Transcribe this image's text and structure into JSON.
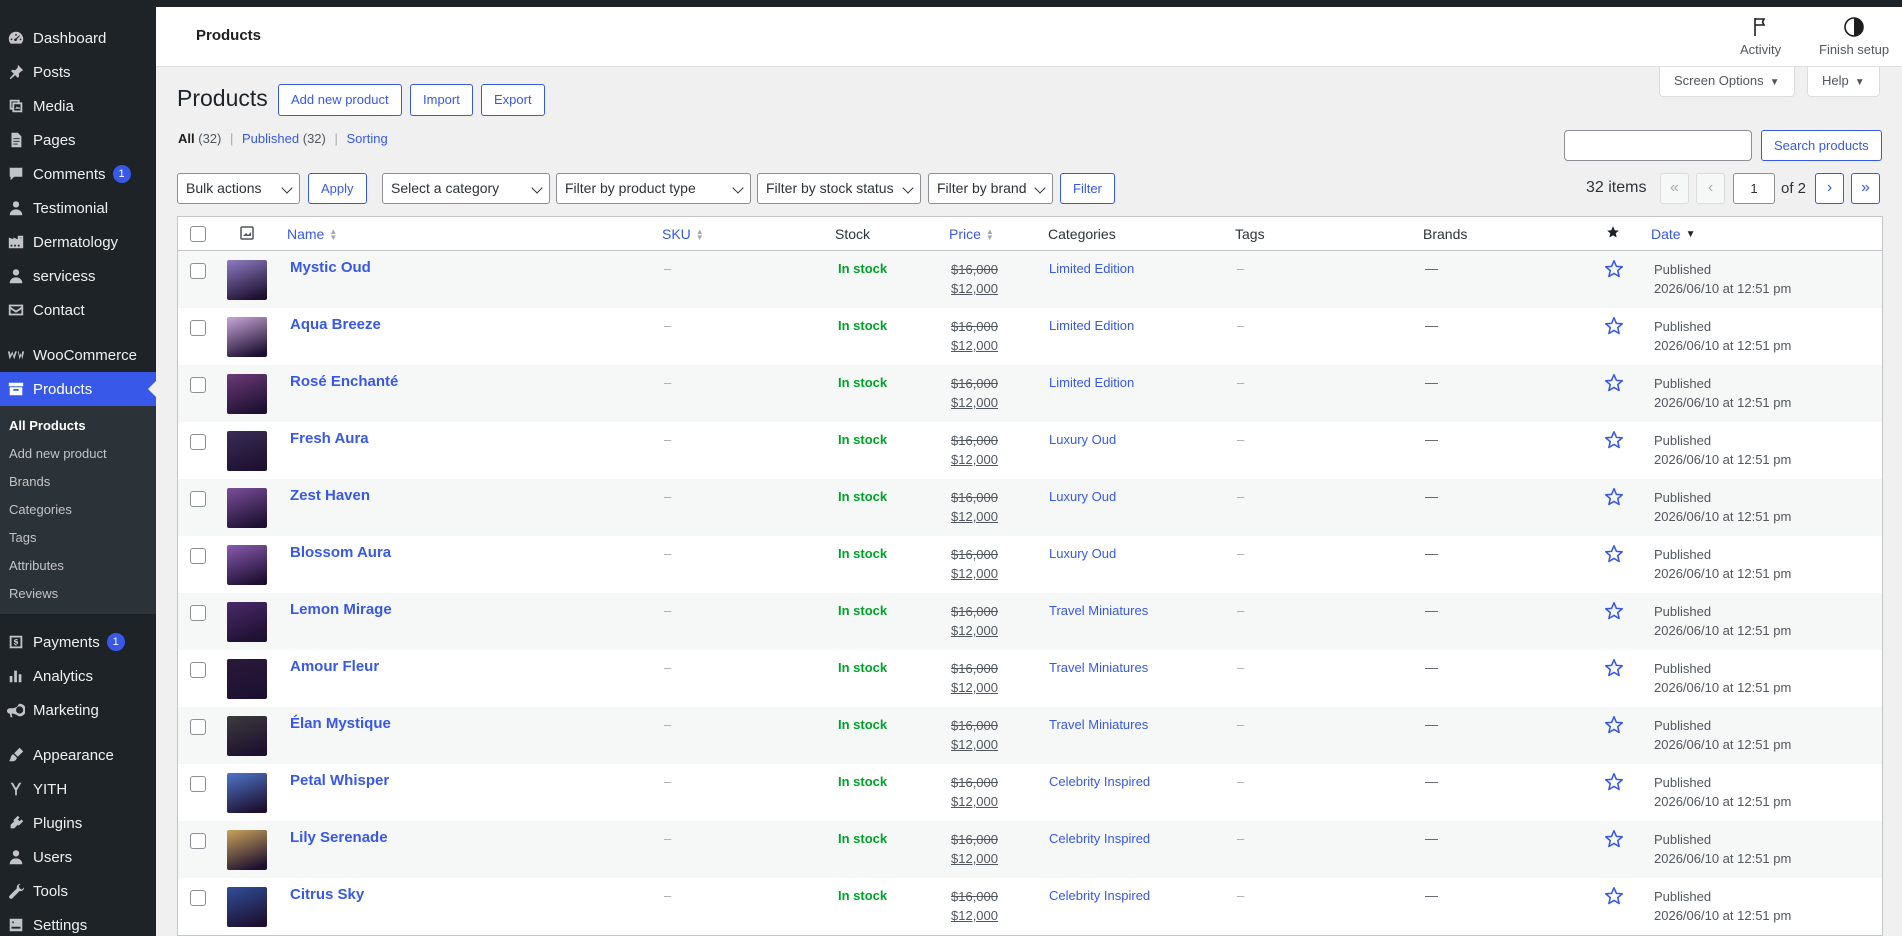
{
  "sidebar": {
    "items": [
      {
        "id": "dashboard",
        "label": "Dashboard",
        "icon": "dashboard-icon"
      },
      {
        "id": "posts",
        "label": "Posts",
        "icon": "pin-icon"
      },
      {
        "id": "media",
        "label": "Media",
        "icon": "media-icon"
      },
      {
        "id": "pages",
        "label": "Pages",
        "icon": "pages-icon"
      },
      {
        "id": "comments",
        "label": "Comments",
        "icon": "comment-icon",
        "badge": "1"
      },
      {
        "id": "testimonial",
        "label": "Testimonial",
        "icon": "user-icon"
      },
      {
        "id": "dermatology",
        "label": "Dermatology",
        "icon": "building-icon"
      },
      {
        "id": "servicess",
        "label": "servicess",
        "icon": "user-icon"
      },
      {
        "id": "contact",
        "label": "Contact",
        "icon": "mail-icon"
      },
      {
        "id": "woocommerce",
        "label": "WooCommerce",
        "icon": "woo-icon"
      },
      {
        "id": "products",
        "label": "Products",
        "icon": "archive-icon"
      }
    ],
    "submenu": [
      {
        "label": "All Products",
        "current": true
      },
      {
        "label": "Add new product"
      },
      {
        "label": "Brands"
      },
      {
        "label": "Categories"
      },
      {
        "label": "Tags"
      },
      {
        "label": "Attributes"
      },
      {
        "label": "Reviews"
      }
    ],
    "items_after": [
      {
        "id": "payments",
        "label": "Payments",
        "icon": "payments-icon",
        "badge": "1"
      },
      {
        "id": "analytics",
        "label": "Analytics",
        "icon": "chart-icon"
      },
      {
        "id": "marketing",
        "label": "Marketing",
        "icon": "megaphone-icon"
      },
      {
        "id": "appearance",
        "label": "Appearance",
        "icon": "brush-icon"
      },
      {
        "id": "yith",
        "label": "YITH",
        "icon": "yith-icon"
      },
      {
        "id": "plugins",
        "label": "Plugins",
        "icon": "plugin-icon"
      },
      {
        "id": "users",
        "label": "Users",
        "icon": "user-icon"
      },
      {
        "id": "tools",
        "label": "Tools",
        "icon": "wrench-icon"
      },
      {
        "id": "settings",
        "label": "Settings",
        "icon": "settings-icon"
      }
    ]
  },
  "header": {
    "breadcrumb": "Products",
    "activity_label": "Activity",
    "finish_setup_label": "Finish setup",
    "screen_options_label": "Screen Options",
    "help_label": "Help"
  },
  "page": {
    "title": "Products",
    "add_new_label": "Add new product",
    "import_label": "Import",
    "export_label": "Export"
  },
  "views": {
    "all_label": "All",
    "all_count": "(32)",
    "published_label": "Published",
    "published_count": "(32)",
    "sorting_label": "Sorting"
  },
  "search": {
    "button_label": "Search products",
    "value": ""
  },
  "filters": {
    "bulk_actions": "Bulk actions",
    "apply_label": "Apply",
    "category": "Select a category",
    "product_type": "Filter by product type",
    "stock_status": "Filter by stock status",
    "brand": "Filter by brand",
    "filter_label": "Filter"
  },
  "pagination": {
    "items_count": "32 items",
    "first": "«",
    "prev": "‹",
    "current_page": "1",
    "of_total": "of 2",
    "next": "›",
    "last": "»"
  },
  "table": {
    "columns": {
      "name": "Name",
      "sku": "SKU",
      "stock": "Stock",
      "price": "Price",
      "categories": "Categories",
      "tags": "Tags",
      "brands": "Brands",
      "date": "Date"
    },
    "rows": [
      {
        "name": "Mystic Oud",
        "sku": "–",
        "stock": "In stock",
        "price_old": "$16,000",
        "price_new": "$12,000",
        "category": "Limited Edition",
        "tags": "–",
        "brands": "—",
        "status": "Published",
        "date": "2026/06/10 at 12:51 pm",
        "thumb": "#8e7cc3"
      },
      {
        "name": "Aqua Breeze",
        "sku": "–",
        "stock": "In stock",
        "price_old": "$16,000",
        "price_new": "$12,000",
        "category": "Limited Edition",
        "tags": "–",
        "brands": "—",
        "status": "Published",
        "date": "2026/06/10 at 12:51 pm",
        "thumb": "#c9a7d8"
      },
      {
        "name": "Rosé Enchanté",
        "sku": "–",
        "stock": "In stock",
        "price_old": "$16,000",
        "price_new": "$12,000",
        "category": "Limited Edition",
        "tags": "–",
        "brands": "—",
        "status": "Published",
        "date": "2026/06/10 at 12:51 pm",
        "thumb": "#6b3a78"
      },
      {
        "name": "Fresh Aura",
        "sku": "–",
        "stock": "In stock",
        "price_old": "$16,000",
        "price_new": "$12,000",
        "category": "Luxury Oud",
        "tags": "–",
        "brands": "—",
        "status": "Published",
        "date": "2026/06/10 at 12:51 pm",
        "thumb": "#3a2d55"
      },
      {
        "name": "Zest Haven",
        "sku": "–",
        "stock": "In stock",
        "price_old": "$16,000",
        "price_new": "$12,000",
        "category": "Luxury Oud",
        "tags": "–",
        "brands": "—",
        "status": "Published",
        "date": "2026/06/10 at 12:51 pm",
        "thumb": "#7a4f9a"
      },
      {
        "name": "Blossom Aura",
        "sku": "–",
        "stock": "In stock",
        "price_old": "$16,000",
        "price_new": "$12,000",
        "category": "Luxury Oud",
        "tags": "–",
        "brands": "—",
        "status": "Published",
        "date": "2026/06/10 at 12:51 pm",
        "thumb": "#8a5ab0"
      },
      {
        "name": "Lemon Mirage",
        "sku": "–",
        "stock": "In stock",
        "price_old": "$16,000",
        "price_new": "$12,000",
        "category": "Travel Miniatures",
        "tags": "–",
        "brands": "—",
        "status": "Published",
        "date": "2026/06/10 at 12:51 pm",
        "thumb": "#4a2a6a"
      },
      {
        "name": "Amour Fleur",
        "sku": "–",
        "stock": "In stock",
        "price_old": "$16,000",
        "price_new": "$12,000",
        "category": "Travel Miniatures",
        "tags": "–",
        "brands": "—",
        "status": "Published",
        "date": "2026/06/10 at 12:51 pm",
        "thumb": "#2a1a3a"
      },
      {
        "name": "Élan Mystique",
        "sku": "–",
        "stock": "In stock",
        "price_old": "$16,000",
        "price_new": "$12,000",
        "category": "Travel Miniatures",
        "tags": "–",
        "brands": "—",
        "status": "Published",
        "date": "2026/06/10 at 12:51 pm",
        "thumb": "#3b3b3b"
      },
      {
        "name": "Petal Whisper",
        "sku": "–",
        "stock": "In stock",
        "price_old": "$16,000",
        "price_new": "$12,000",
        "category": "Celebrity Inspired",
        "tags": "–",
        "brands": "—",
        "status": "Published",
        "date": "2026/06/10 at 12:51 pm",
        "thumb": "#4f76c9"
      },
      {
        "name": "Lily Serenade",
        "sku": "–",
        "stock": "In stock",
        "price_old": "$16,000",
        "price_new": "$12,000",
        "category": "Celebrity Inspired",
        "tags": "–",
        "brands": "—",
        "status": "Published",
        "date": "2026/06/10 at 12:51 pm",
        "thumb": "#c9a25a"
      },
      {
        "name": "Citrus Sky",
        "sku": "–",
        "stock": "In stock",
        "price_old": "$16,000",
        "price_new": "$12,000",
        "category": "Celebrity Inspired",
        "tags": "–",
        "brands": "—",
        "status": "Published",
        "date": "2026/06/10 at 12:51 pm",
        "thumb": "#2f4f9a"
      }
    ]
  },
  "colors": {
    "accent": "#3858e9",
    "sidebar_bg": "#1d2327",
    "in_stock": "#00a32a"
  }
}
